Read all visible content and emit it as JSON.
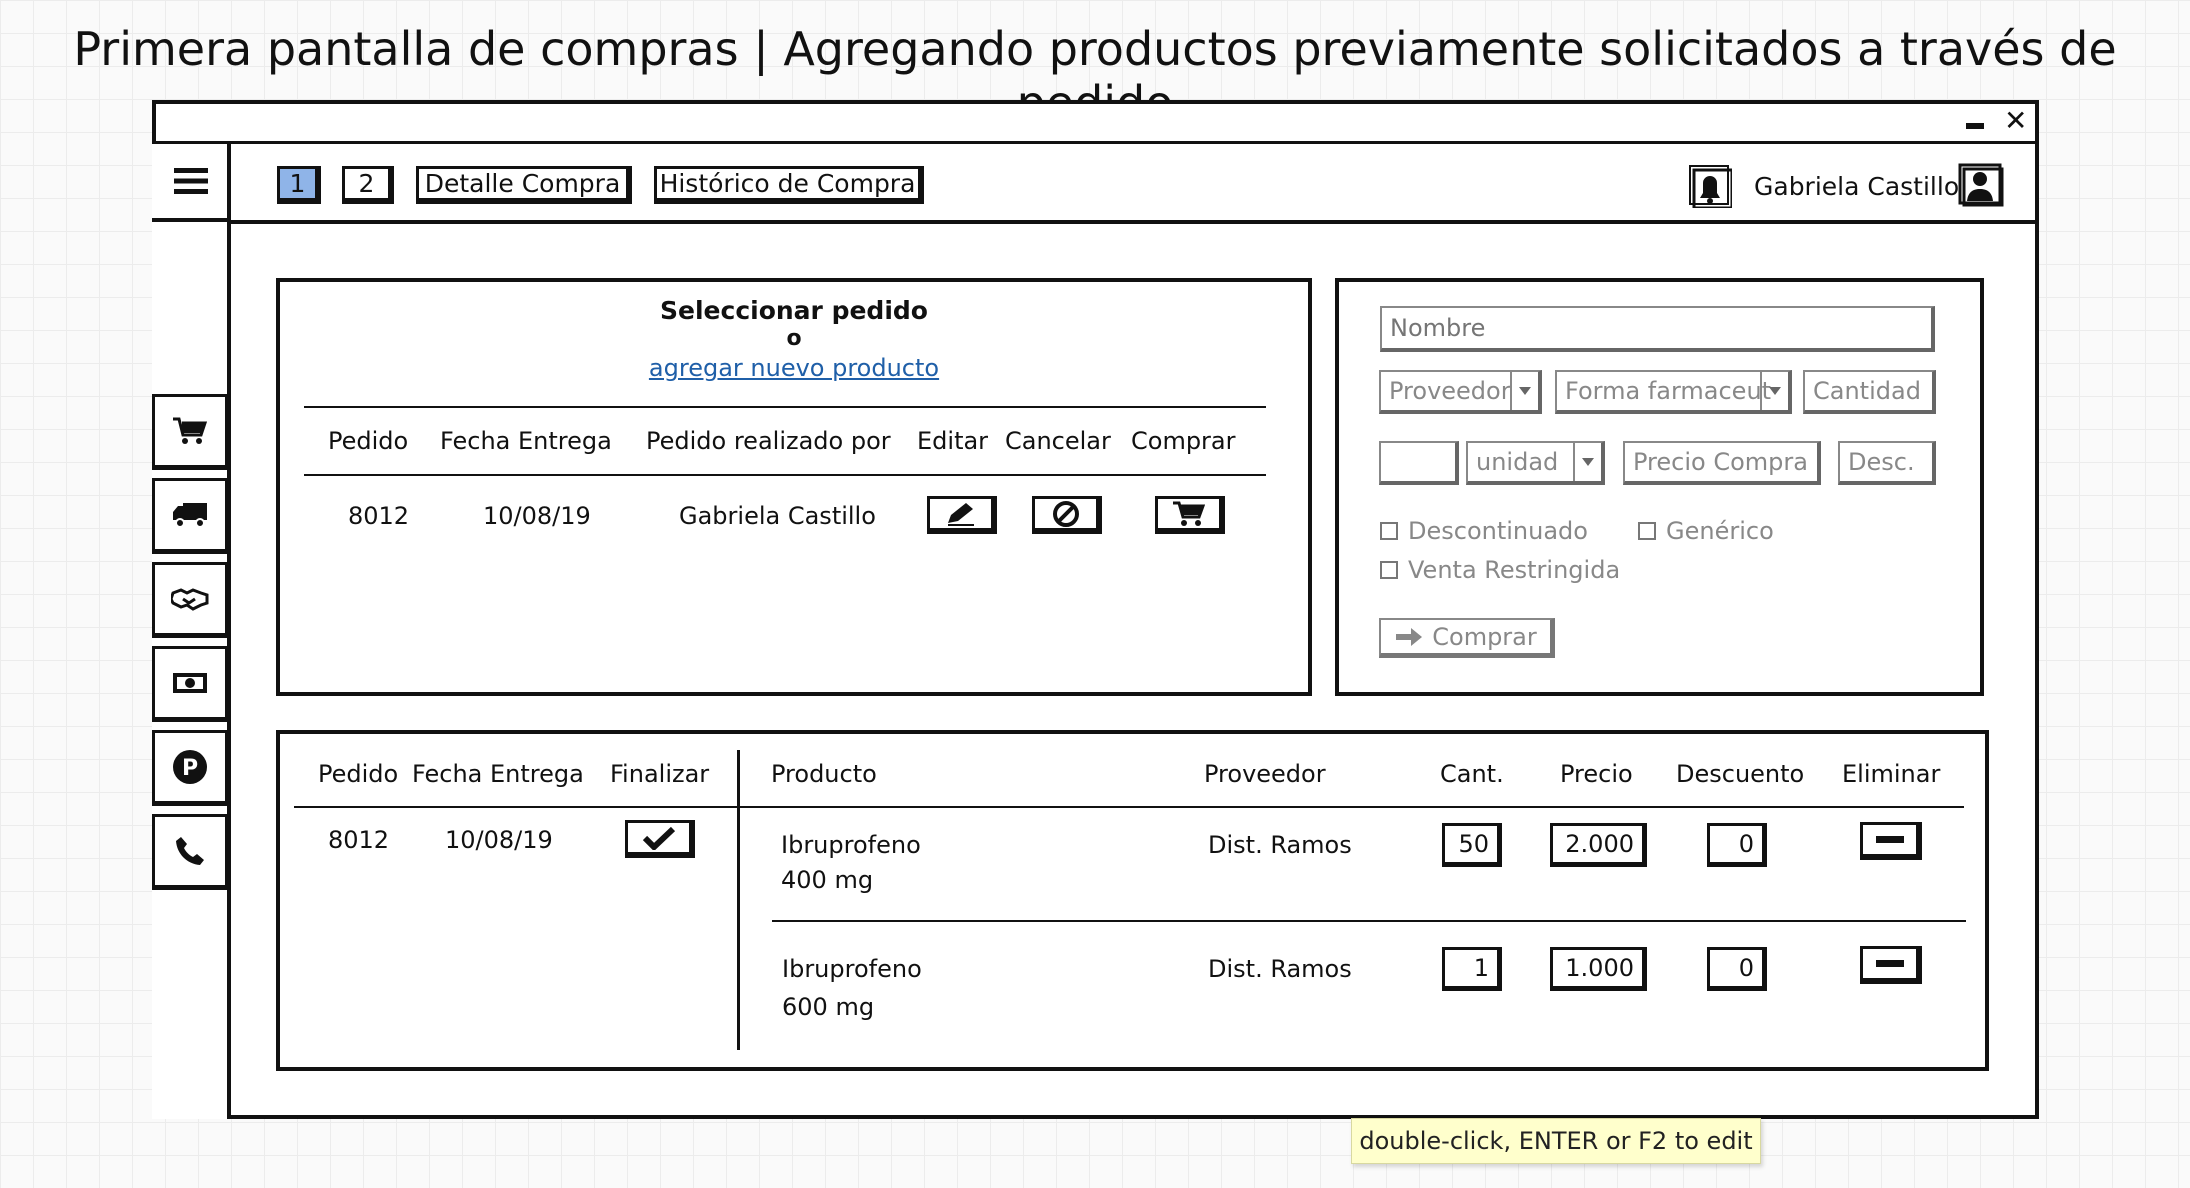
{
  "page_title": "Primera pantalla de compras | Agregando productos previamente solicitados a través de pedido",
  "window": {
    "minimize_icon": "minimize-icon",
    "close_icon": "close-icon",
    "close_glyph": "✕"
  },
  "sidebar": {
    "menu_icon": "hamburger-menu-icon",
    "items": [
      {
        "icon": "cart-icon"
      },
      {
        "icon": "truck-icon"
      },
      {
        "icon": "handshake-icon"
      },
      {
        "icon": "money-icon"
      },
      {
        "icon": "parking-icon"
      },
      {
        "icon": "phone-icon"
      }
    ]
  },
  "topbar": {
    "page_buttons": [
      "1",
      "2"
    ],
    "active_page": "1",
    "tabs": [
      "Detalle Compra",
      "Histórico de Compra"
    ],
    "user_name": "Gabriela Castillo",
    "notification_icon": "bell-icon",
    "avatar_icon": "user-icon"
  },
  "order_panel": {
    "heading": "Seleccionar pedido",
    "or_text": "o",
    "add_link": "agregar nuevo producto",
    "columns": [
      "Pedido",
      "Fecha Entrega",
      "Pedido realizado por",
      "Editar",
      "Cancelar",
      "Comprar"
    ],
    "rows": [
      {
        "pedido": "8012",
        "fecha": "10/08/19",
        "por": "Gabriela Castillo"
      }
    ]
  },
  "product_form": {
    "nombre_placeholder": "Nombre",
    "proveedor_placeholder": "Proveedor",
    "forma_placeholder": "Forma farmaceut",
    "cantidad_placeholder": "Cantidad",
    "unidad_placeholder": "unidad",
    "precio_placeholder": "Precio Compra",
    "desc_placeholder": "Desc.",
    "checkboxes": [
      "Descontinuado",
      "Genérico",
      "Venta Restringida"
    ],
    "comprar_button": "Comprar"
  },
  "purchase_panel": {
    "left_columns": [
      "Pedido",
      "Fecha Entrega",
      "Finalizar"
    ],
    "left_row": {
      "pedido": "8012",
      "fecha": "10/08/19"
    },
    "columns": [
      "Producto",
      "Proveedor",
      "Cant.",
      "Precio",
      "Descuento",
      "Eliminar"
    ],
    "items": [
      {
        "producto": "Ibruprofeno",
        "dosis": "400 mg",
        "proveedor": "Dist. Ramos",
        "cant": "50",
        "precio": "2.000",
        "descuento": "0"
      },
      {
        "producto": "Ibruprofeno",
        "dosis": "600 mg",
        "proveedor": "Dist. Ramos",
        "cant": "1",
        "precio": "1.000",
        "descuento": "0"
      }
    ]
  },
  "tooltip": "double-click, ENTER or F2 to edit"
}
